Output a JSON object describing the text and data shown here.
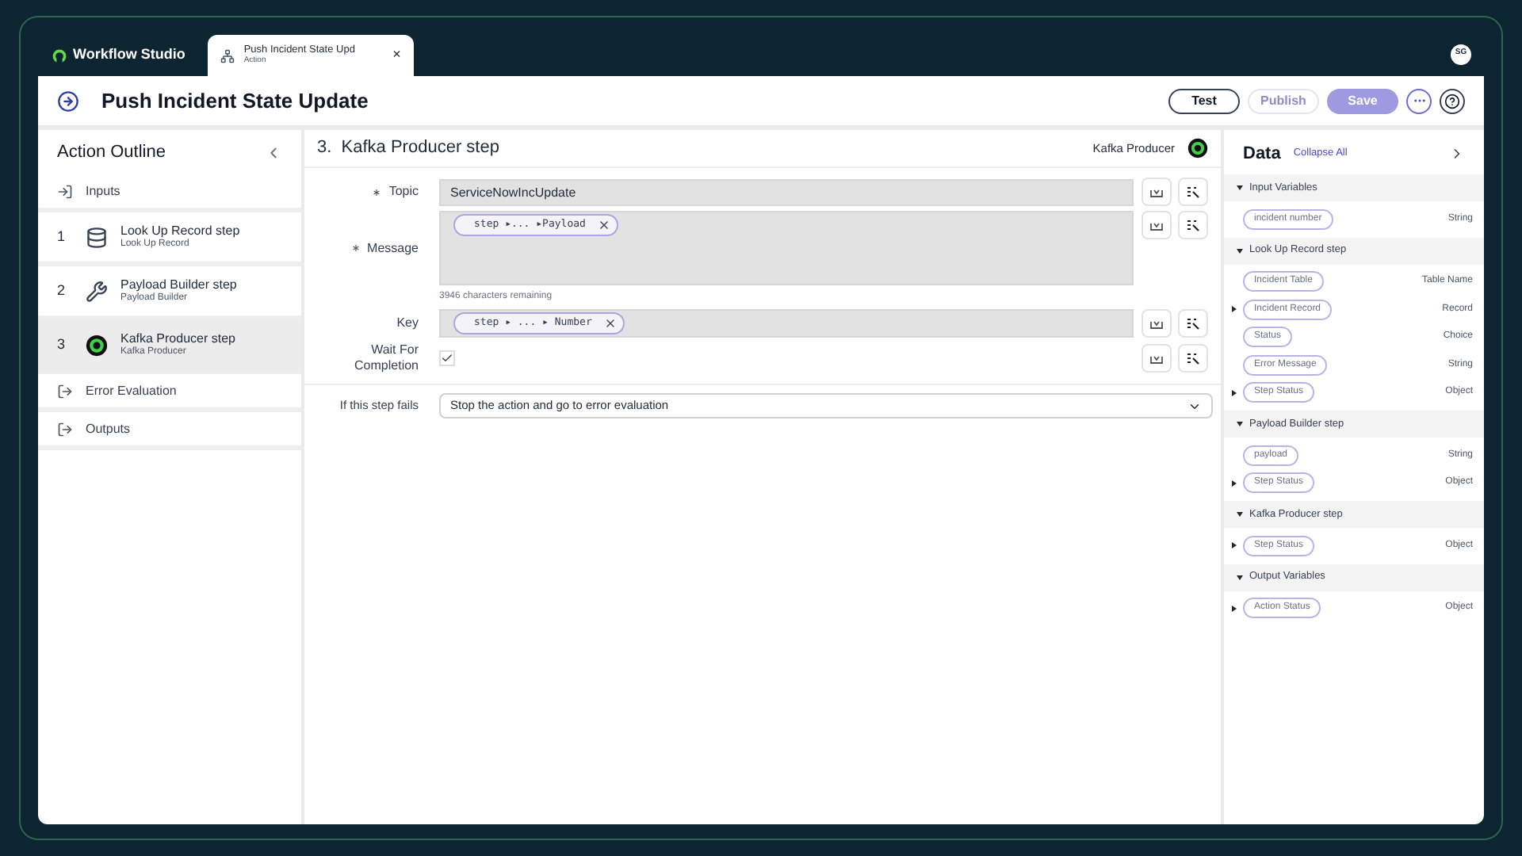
{
  "top_bar": {
    "brand": "Workflow Studio",
    "tab": {
      "title": "Push Incident State Upd",
      "subtitle": "Action",
      "close": "×"
    },
    "avatar": "SG"
  },
  "header": {
    "title": "Push Incident State Update",
    "buttons": [
      {
        "label": "Test",
        "disabled": false,
        "kind": "outline"
      },
      {
        "label": "Publish",
        "disabled": true,
        "kind": "outline"
      },
      {
        "label": "Save",
        "disabled": true,
        "kind": "primary"
      }
    ]
  },
  "outline": {
    "title": "Action Outline",
    "items": [
      {
        "kind": "section",
        "label": "Inputs"
      },
      {
        "kind": "step",
        "number": "1",
        "title": "Look Up Record step",
        "subtitle": "Look Up Record",
        "selected": false
      },
      {
        "kind": "step",
        "number": "2",
        "title": "Payload Builder step",
        "subtitle": "Payload Builder",
        "selected": false
      },
      {
        "kind": "step",
        "number": "3",
        "title": "Kafka Producer step",
        "subtitle": "Kafka Producer",
        "selected": true
      },
      {
        "kind": "section",
        "label": "Error Evaluation"
      },
      {
        "kind": "section",
        "label": "Outputs"
      }
    ]
  },
  "step": {
    "title": "3.  Kafka Producer step",
    "type": "Kafka Producer",
    "fields": [
      {
        "kind": "text",
        "label": "Topic",
        "required": true,
        "value": "ServiceNowIncUpdate"
      },
      {
        "kind": "pills",
        "label": "Message",
        "required": true,
        "tall": true,
        "pill": "step ▸... ▸Payload",
        "hint": "3946 characters remaining"
      },
      {
        "kind": "pills",
        "label": "Key",
        "required": false,
        "tall": false,
        "pill": "step ▸ ... ▸ Number"
      },
      {
        "kind": "checkbox",
        "label": "Wait For Completion",
        "required": false,
        "checked": true
      }
    ],
    "on_fail": {
      "label": "If this step fails",
      "value": "Stop the action and go to error evaluation"
    }
  },
  "data": {
    "title": "Data",
    "collapse": "Collapse All",
    "sections": [
      {
        "title": "Input Variables",
        "expanded": true,
        "items": [
          {
            "label": "incident number",
            "type": "String",
            "expandable": false
          }
        ]
      },
      {
        "title": "Look Up Record step",
        "expanded": true,
        "items": [
          {
            "label": "Incident Table",
            "type": "Table Name",
            "expandable": false
          },
          {
            "label": "Incident Record",
            "type": "Record",
            "expandable": true
          },
          {
            "label": "Status",
            "type": "Choice",
            "expandable": false
          },
          {
            "label": "Error Message",
            "type": "String",
            "expandable": false
          },
          {
            "label": "Step Status",
            "type": "Object",
            "expandable": true
          }
        ]
      },
      {
        "title": "Payload Builder step",
        "expanded": true,
        "items": [
          {
            "label": "payload",
            "type": "String",
            "expandable": false
          },
          {
            "label": "Step Status",
            "type": "Object",
            "expandable": true
          }
        ]
      },
      {
        "title": "Kafka Producer step",
        "expanded": true,
        "items": [
          {
            "label": "Step Status",
            "type": "Object",
            "expandable": true
          }
        ]
      },
      {
        "title": "Output Variables",
        "expanded": true,
        "items": [
          {
            "label": "Action Status",
            "type": "Object",
            "expandable": true
          }
        ]
      }
    ]
  }
}
